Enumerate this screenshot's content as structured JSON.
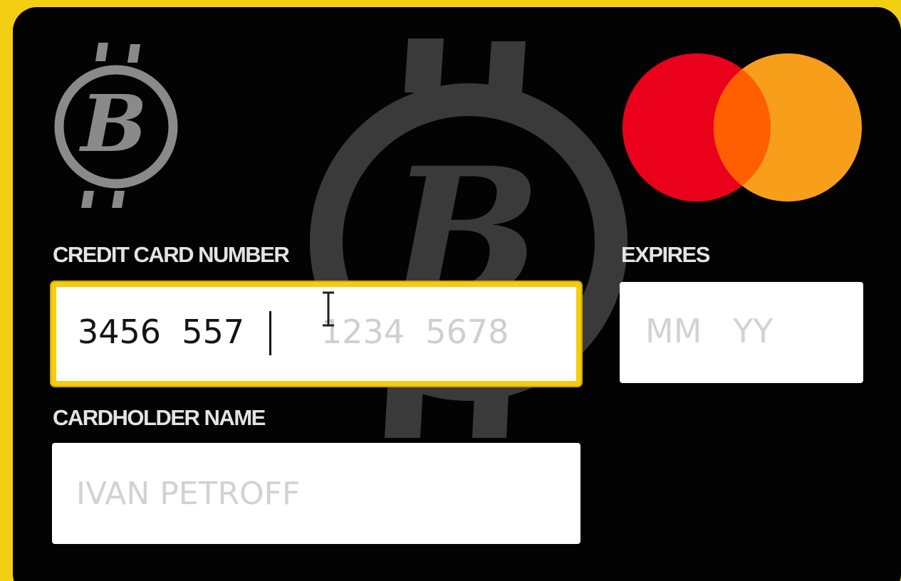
{
  "card": {
    "brand_icon": "bitcoin-b-logo-icon",
    "network_icon": "mastercard-logo-icon",
    "colors": {
      "background": "#f2cf12",
      "card": "#030303",
      "focus_border": "#f5cc10",
      "mastercard_red": "#eb001b",
      "mastercard_orange": "#f79e1b",
      "mastercard_overlap": "#ff5f00"
    }
  },
  "number": {
    "label": "CREDIT CARD NUMBER",
    "value": "3456  557",
    "placeholder": "1234  5678"
  },
  "expires": {
    "label": "EXPIRES",
    "placeholder": "MM   YY"
  },
  "name": {
    "label": "CARDHOLDER NAME",
    "placeholder": "IVAN PETROFF"
  },
  "cursor_icon": "text-cursor-icon"
}
